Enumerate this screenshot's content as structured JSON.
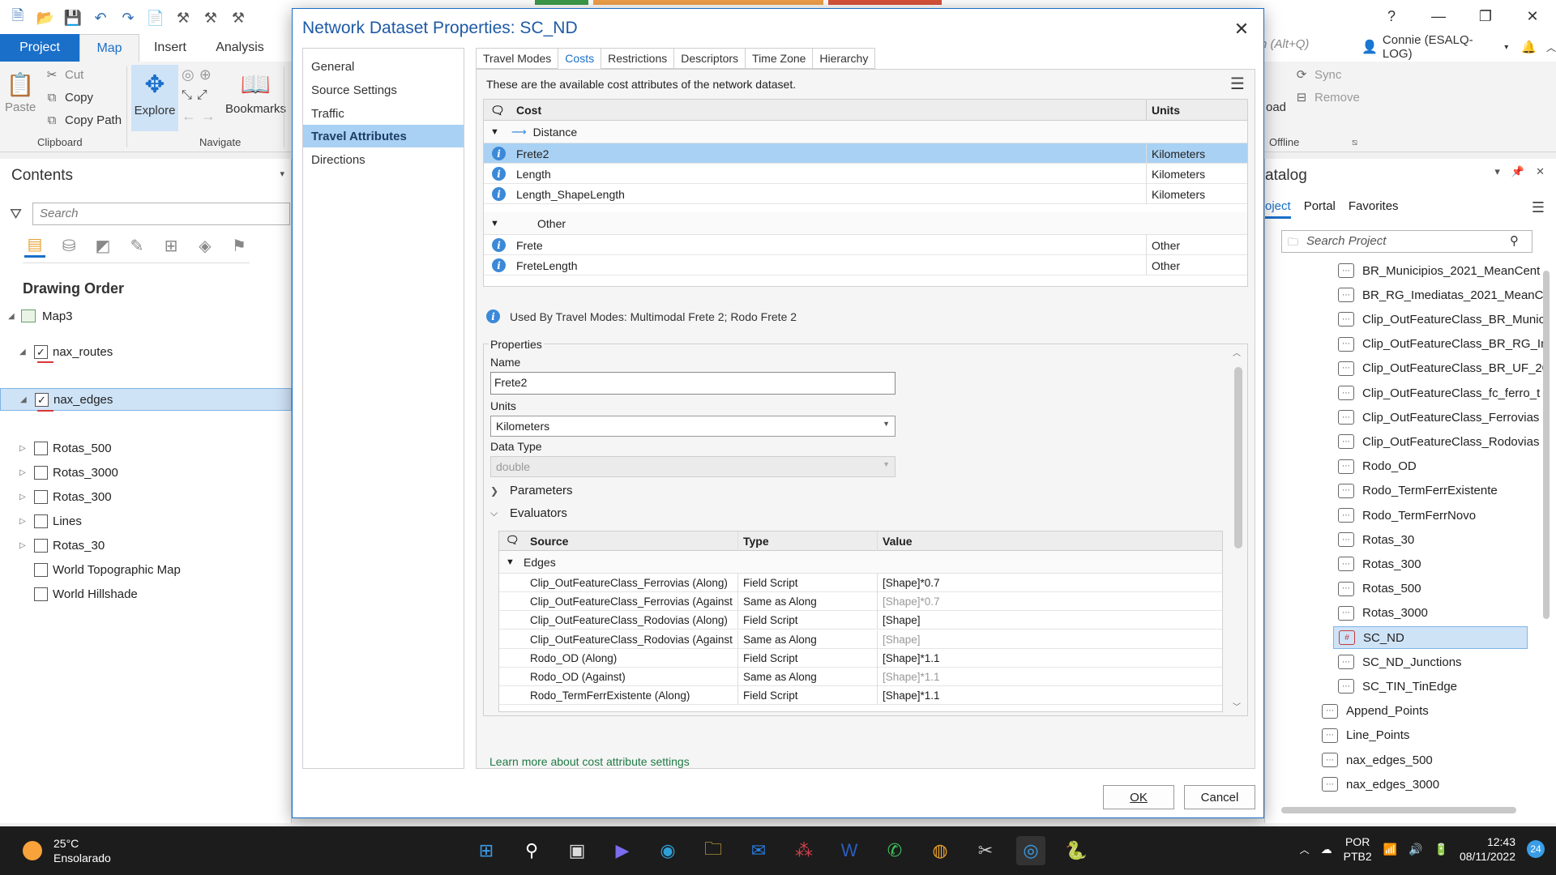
{
  "app": {
    "cmd_search_placeholder": "h (Alt+Q)",
    "user": "Connie (ESALQ-LOG)",
    "help": "?",
    "minimize": "—",
    "maximize": "❐",
    "close": "✕"
  },
  "ribbon": {
    "tabs": [
      "Project",
      "Map",
      "Insert",
      "Analysis"
    ],
    "clipboard": {
      "paste": "Paste",
      "cut": "Cut",
      "copy": "Copy",
      "copy_path": "Copy Path",
      "label": "Clipboard"
    },
    "navigate": {
      "explore": "Explore",
      "bookmarks": "Bookmarks",
      "label": "Navigate"
    },
    "offline": {
      "load": "oad",
      "sync": "Sync",
      "remove": "Remove",
      "label": "Offline"
    }
  },
  "contents": {
    "title": "Contents",
    "search_placeholder": "Search",
    "drawing_order": "Drawing Order",
    "map": "Map3",
    "layers": [
      {
        "name": "nax_routes",
        "checked": true
      },
      {
        "name": "nax_edges",
        "checked": true
      },
      {
        "name": "Rotas_500",
        "checked": false
      },
      {
        "name": "Rotas_3000",
        "checked": false
      },
      {
        "name": "Rotas_300",
        "checked": false
      },
      {
        "name": "Lines",
        "checked": false
      },
      {
        "name": "Rotas_30",
        "checked": false
      },
      {
        "name": "World Topographic Map",
        "checked": false
      },
      {
        "name": "World Hillshade",
        "checked": false
      }
    ]
  },
  "catalog": {
    "title": "atalog",
    "tabs": [
      "oject",
      "Portal",
      "Favorites"
    ],
    "search_placeholder": "Search Project",
    "items": [
      "BR_Municipios_2021_MeanCent",
      "BR_RG_Imediatas_2021_MeanC",
      "Clip_OutFeatureClass_BR_Munic",
      "Clip_OutFeatureClass_BR_RG_In",
      "Clip_OutFeatureClass_BR_UF_20",
      "Clip_OutFeatureClass_fc_ferro_t",
      "Clip_OutFeatureClass_Ferrovias",
      "Clip_OutFeatureClass_Rodovias",
      "Rodo_OD",
      "Rodo_TermFerrExistente",
      "Rodo_TermFerrNovo",
      "Rotas_30",
      "Rotas_300",
      "Rotas_500",
      "Rotas_3000",
      "SC_ND",
      "SC_ND_Junctions",
      "SC_TIN_TinEdge"
    ],
    "items2": [
      "Append_Points",
      "Line_Points",
      "nax_edges_500",
      "nax_edges_3000"
    ]
  },
  "dialog": {
    "title": "Network Dataset Properties: SC_ND",
    "nav": [
      "General",
      "Source Settings",
      "Traffic",
      "Travel Attributes",
      "Directions"
    ],
    "tabs": [
      "Travel Modes",
      "Costs",
      "Restrictions",
      "Descriptors",
      "Time Zone",
      "Hierarchy"
    ],
    "available_text": "These are the available cost attributes of the network dataset.",
    "grid_headers": {
      "cost": "Cost",
      "units": "Units"
    },
    "groups": [
      {
        "name": "Distance",
        "rows": [
          {
            "name": "Frete2",
            "units": "Kilometers"
          },
          {
            "name": "Length",
            "units": "Kilometers"
          },
          {
            "name": "Length_ShapeLength",
            "units": "Kilometers"
          }
        ]
      },
      {
        "name": "Other",
        "rows": [
          {
            "name": "Frete",
            "units": "Other"
          },
          {
            "name": "FreteLength",
            "units": "Other"
          }
        ]
      }
    ],
    "used_by": "Used By Travel Modes: Multimodal Frete 2; Rodo Frete 2",
    "properties": {
      "legend": "Properties",
      "name_label": "Name",
      "name_value": "Frete2",
      "units_label": "Units",
      "units_value": "Kilometers",
      "datatype_label": "Data Type",
      "datatype_value": "double",
      "parameters": "Parameters",
      "evaluators": "Evaluators"
    },
    "eval_headers": {
      "source": "Source",
      "type": "Type",
      "value": "Value"
    },
    "eval_group": "Edges",
    "eval_rows": [
      {
        "source": "Clip_OutFeatureClass_Ferrovias (Along)",
        "type": "Field Script",
        "value": "[Shape]*0.7",
        "dim": false
      },
      {
        "source": "Clip_OutFeatureClass_Ferrovias (Against)",
        "type": "Same as Along",
        "value": "[Shape]*0.7",
        "dim": true
      },
      {
        "source": "Clip_OutFeatureClass_Rodovias (Along)",
        "type": "Field Script",
        "value": "[Shape]",
        "dim": false
      },
      {
        "source": "Clip_OutFeatureClass_Rodovias (Against)",
        "type": "Same as Along",
        "value": "[Shape]",
        "dim": true
      },
      {
        "source": "Rodo_OD (Along)",
        "type": "Field Script",
        "value": "[Shape]*1.1",
        "dim": false
      },
      {
        "source": "Rodo_OD (Against)",
        "type": "Same as Along",
        "value": "[Shape]*1.1",
        "dim": true
      },
      {
        "source": "Rodo_TermFerrExistente (Along)",
        "type": "Field Script",
        "value": "[Shape]*1.1",
        "dim": false
      }
    ],
    "learn_more": "Learn more about cost attribute settings",
    "ok": "OK",
    "cancel": "Cancel"
  },
  "taskbar": {
    "temp": "25°C",
    "weather": "Ensolarado",
    "lang1": "POR",
    "lang2": "PTB2",
    "time": "12:43",
    "date": "08/11/2022",
    "badge": "24"
  },
  "colors": {
    "accent": "#1a6fc9",
    "selected_row": "#a9d1f3",
    "link": "#1f7a45"
  }
}
